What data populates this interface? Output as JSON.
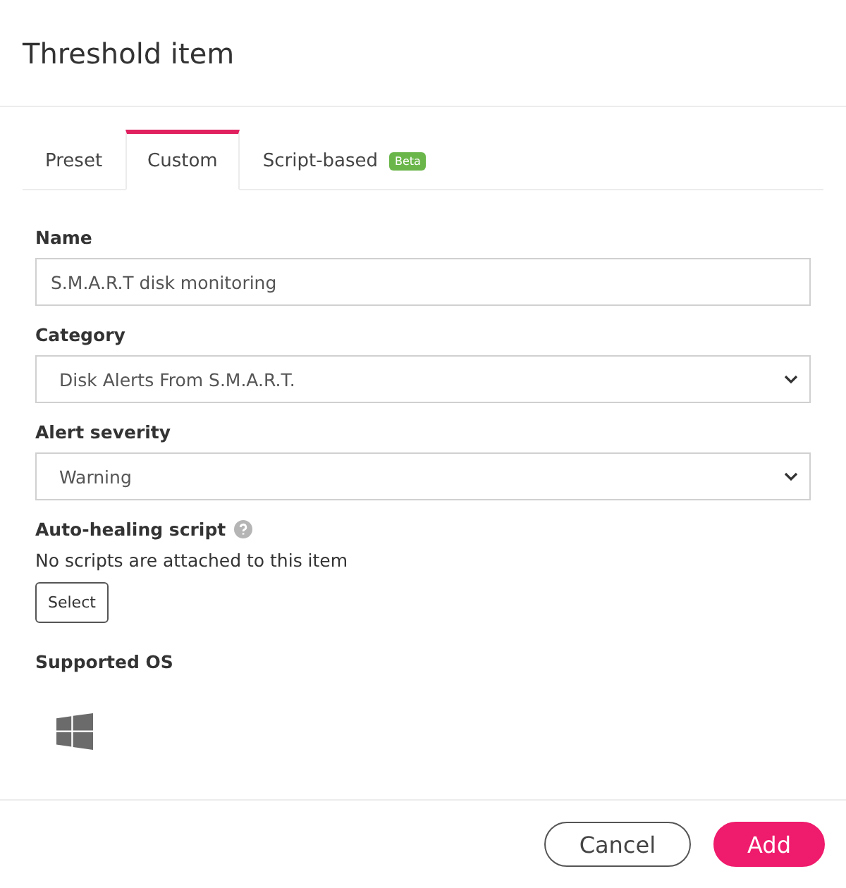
{
  "dialog": {
    "title": "Threshold item"
  },
  "tabs": [
    {
      "label": "Preset",
      "selected": false
    },
    {
      "label": "Custom",
      "selected": true
    },
    {
      "label": "Script-based",
      "selected": false,
      "badge": "Beta"
    }
  ],
  "form": {
    "fields": [
      {
        "kind": "text",
        "label": "Name",
        "value": "S.M.A.R.T disk monitoring"
      },
      {
        "kind": "select",
        "label": "Category",
        "value": "Disk Alerts From S.M.A.R.T."
      },
      {
        "kind": "select",
        "label": "Alert severity",
        "value": "Warning"
      }
    ],
    "auto_healing": {
      "label": "Auto-healing script",
      "message": "No scripts are attached to this item",
      "button": "Select"
    },
    "supported_os": {
      "label": "Supported OS"
    }
  },
  "footer": {
    "buttons": [
      {
        "kind": "secondary",
        "label": "Cancel"
      },
      {
        "kind": "primary",
        "label": "Add"
      }
    ]
  }
}
